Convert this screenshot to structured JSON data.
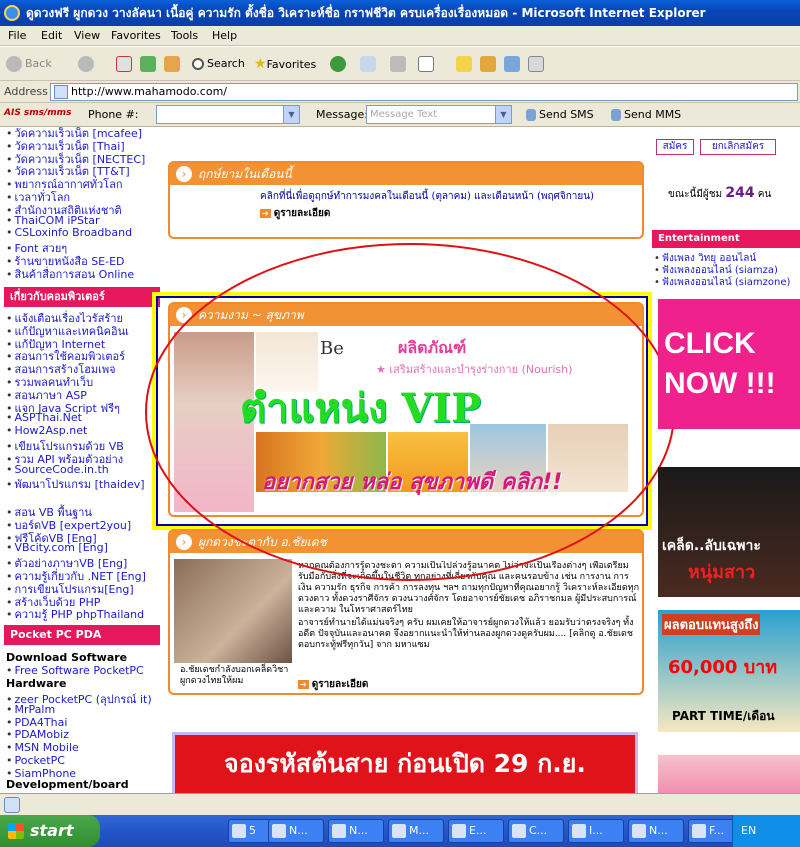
{
  "window": {
    "title": "ดูดวงฟรี ผูกดวง วางลัคนา เนื้อคู่ ความรัก ตั้งชื่อ วิเคราะห์ชื่อ กราฟชีวิต ครบเครื่องเรื่องหมอด - Microsoft Internet Explorer"
  },
  "menu": [
    "File",
    "Edit",
    "View",
    "Favorites",
    "Tools",
    "Help"
  ],
  "toolbar": {
    "back": "Back",
    "search": "Search",
    "favorites": "Favorites"
  },
  "address": {
    "label": "Address",
    "url": "http://www.mahamodo.com/"
  },
  "smsbar": {
    "brand": "AIS sms/mms",
    "phone_label": "Phone #:",
    "message_label": "Message:",
    "message_placeholder": "Message Text",
    "send_sms": "Send SMS",
    "send_mms": "Send MMS"
  },
  "left": {
    "top_links": [
      "วัดความเร็วเน็ต [mcafee]",
      "วัดความเร็วเน็ต [Thai]",
      "วัดความเร็วเน็ต [NECTEC]",
      "วัดความเร็วเน็ต [TT&T]",
      "พยากรณ์อากาศทั่วโลก",
      "เวลาทั่วโลก",
      "สำนักงานสถิติแห่งชาติ",
      "ThaiCOM iPStar",
      "CSLoxinfo Broadband",
      "Font สวยๆ",
      "ร้านขายหนังสือ SE-ED",
      "สินค้าสื่อการสอน Online"
    ],
    "section1": "เกี่ยวกับคอมพิวเตอร์",
    "comp_links": [
      "แจ้งเตือนเรื่องไวรัสร้าย",
      "แก้ปัญหาและเทคนิคอินเ",
      "แก้ปัญหา Internet",
      "สอนการใช้คอมพิวเตอร์",
      "สอนการสร้างโฮมเพจ",
      "รวมพลคนทำเว็บ",
      "สอนภาษา ASP",
      "แจก Java Script ฟรีๆ",
      "ASPThai.Net",
      "How2Asp.net",
      "เขียนโปรแกรมด้วย VB",
      "รวม API พร้อมตัวอย่าง",
      "SourceCode.in.th",
      "พัฒนาโปรแกรม [thaidev]"
    ],
    "vb_links": [
      "สอน VB พื้นฐาน",
      "บอร์ดVB [expert2you]",
      "ฟรีโค้ดVB [Eng]",
      "VBcity.com [Eng]",
      "ตัวอย่างภาษาVB [Eng]",
      "ความรู้เกี่ยวกับ .NET [Eng]",
      "การเขียนโปรแกรม[Eng]",
      "สร้างเว็บด้วย PHP",
      "ความรู้ PHP phpThailand"
    ],
    "section2": "Pocket PC  PDA",
    "download_title": "Download Software",
    "free_sw": "Free Software PocketPC",
    "hardware_title": "Hardware",
    "hw_links": [
      "zeer PocketPC (ลุปกรณ์ it)",
      "MrPalm",
      "PDA4Thai",
      "PDAMobiz",
      "MSN Mobile",
      "PocketPC",
      "SiamPhone"
    ],
    "dev_title": "Development/board"
  },
  "center": {
    "box1": {
      "title": "ฤกษ์ยามในเดือนนี้",
      "text": "คลิกที่นี่เพื่อดูฤกษ์ทำการมงคลในเดือนนี้    (ตุลาคม)    และเดือนหน้า (พฤศจิกายน)",
      "more": "ดูรายละเอียด"
    },
    "box2": {
      "title": "ความงาม ~ สุขภาพ",
      "product": "ผลิตภัณฑ์",
      "bullet": "★ เสริมสร้างและบำรุงร่างกาย (Nourish)",
      "brand": "Be",
      "vip": "ตำแหน่ง VIP",
      "slogan": "อยากสวย หล่อ สุขภาพดี คลิก!!"
    },
    "box3": {
      "title": "ผูกดวงชะตากับ อ.ชัยเดช",
      "text": "หากคุณต้องการรู้ดวงชะตา ความเป็นไปล่วงรู้อนาคต ไม่ว่าจะเป็นเรื่องต่างๆ เพื่อเตรียมรับมือกับสิ่งที่จะเกิดขึ้นในชีวิต ทุกอย่างที่เกี่ยวกับคุณ และคนรอบข้าง เช่น การงาน การเงิน ความรัก ธุรกิจ การค้า การลงทุน ฯลฯ ถามทุกปัญหาที่คุณอยากรู้ วิเคราะห์ละเอียดทุกดวงดาว ทั้งดวงราศีจักร ดวงนวางศ์จักร โดยอาจารย์ชัยเดช อภิราชกมล ผู้มีประสบการณ์และความ ในโหราศาสตร์ไทย",
      "text2": "อาจารย์ทำนายได้แม่นจริงๆ ครับ ผมเคยให้อาจารย์ผูกดวงให้แล้ว ยอมรับว่าตรงจริงๆ ทั้งอดีต ปัจจุบันและอนาคต จึงอยากแนะนำให้ท่านลองผูกดวงดูครับผม.... [คลิกดู อ.ชัยเดช ตอบกระทู้ฟรีทุกวัน] จาก มหาแซม",
      "caption": "อ.ชัยเดชกำลังบอกเคล็ดวิชาผูกดวงไทยให้ผม",
      "more": "ดูรายละเอียด"
    },
    "banner": "จองรหัสต้นสาย ก่อนเปิด 29 ก.ย."
  },
  "right": {
    "btn1": "สมัคร",
    "btn2": "ยกเลิกสมัคร",
    "online_label": "ขณะนี้มีผู้ชม",
    "online_count": "244",
    "online_unit": "คน",
    "ent_title": "Entertainment",
    "ent_links": [
      "ฟังเพลง วิทยุ ออนไลน์",
      "ฟังเพลงออนไลน์ (siamza)",
      "ฟังเพลงออนไลน์ (siamzone)"
    ],
    "click": "CLICK NOW !!!",
    "ad2": "เคล็ด..ลับเฉพาะ",
    "ad2b": "หนุ่มสาว",
    "ad3": "ผลตอบแทนสูงถึง",
    "ad3amt": "60,000 บาท",
    "ad3c": "PART TIME/เดือน"
  },
  "taskbar": {
    "start": "start",
    "tasks": [
      "5",
      "N...",
      "N...",
      "M...",
      "E...",
      "C...",
      "I...",
      "N...",
      "F..."
    ],
    "lang": "EN"
  }
}
